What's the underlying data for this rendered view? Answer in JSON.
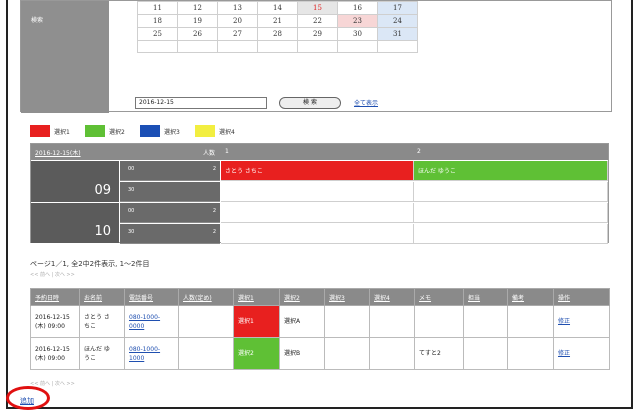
{
  "search": {
    "label": "検索",
    "date_value": "2016-12-15",
    "button_label": "検 索",
    "show_all_label": "全て表示"
  },
  "calendar": {
    "rows": [
      [
        "11",
        "12",
        "13",
        "14",
        "15",
        "16",
        "17"
      ],
      [
        "18",
        "19",
        "20",
        "21",
        "22",
        "23",
        "24"
      ],
      [
        "25",
        "26",
        "27",
        "28",
        "29",
        "30",
        "31"
      ],
      [
        "",
        "",
        "",
        "",
        "",
        "",
        ""
      ]
    ]
  },
  "legend": [
    {
      "label": "選択1",
      "color": "#e8201f"
    },
    {
      "label": "選択2",
      "color": "#5fc035"
    },
    {
      "label": "選択3",
      "color": "#1b4fb5"
    },
    {
      "label": "選択4",
      "color": "#f2ee40"
    }
  ],
  "schedule": {
    "date": "2016-12-15(木)",
    "count_header": "人数",
    "col1": "1",
    "col2": "2",
    "hour1": "09",
    "hour2": "10",
    "minute_00": "00",
    "minute_30": "30",
    "count": "2",
    "booking1_name": "さとう さちこ",
    "booking2_name": "ほんだ ゆうこ",
    "booking1_color": "#e8201f",
    "booking2_color": "#5fc035"
  },
  "pager": {
    "text": "ページ1／1, 全2中2件表示, 1～2件目",
    "sub": "<< 前へ | 次へ >>"
  },
  "table": {
    "headers": [
      "予約日時",
      "お名前",
      "電話番号",
      "人数(定め)",
      "選択1",
      "選択2",
      "選択3",
      "選択4",
      "メモ",
      "担当",
      "備考",
      "操作"
    ],
    "rows": [
      {
        "date": "2016-12-15",
        "time": "(木) 09:00",
        "name1": "さとう さ",
        "name2": "ちこ",
        "phone1": "080-1000-",
        "phone2": "0000",
        "sel1": "選択1",
        "sel2": "選択A",
        "memo": "",
        "action": "修正"
      },
      {
        "date": "2016-12-15",
        "time": "(木) 09:00",
        "name1": "ほんだ ゆ",
        "name2": "うこ",
        "phone1": "080-1000-",
        "phone2": "1000",
        "sel1": "選択2",
        "sel2": "選択B",
        "memo": "てすと2",
        "action": "修正"
      }
    ]
  },
  "bottom_sub": "<< 前へ | 次へ >>",
  "add_label": "追加",
  "highlight_color": "#e01010"
}
